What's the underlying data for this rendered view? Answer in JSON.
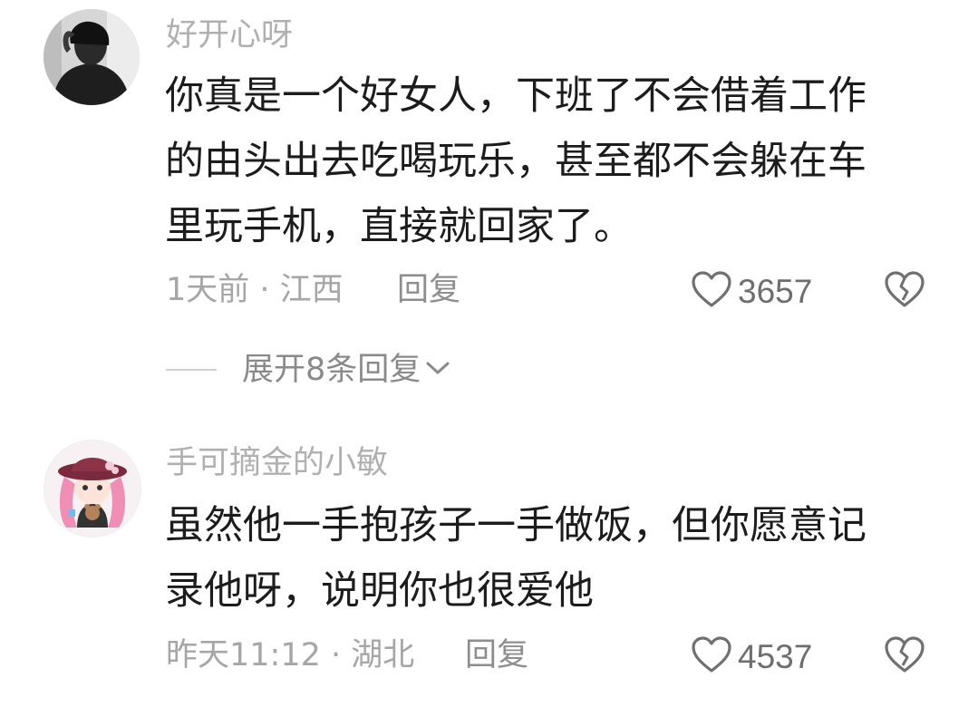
{
  "comments": [
    {
      "username": "好开心呀",
      "content_lines": [
        "你真是一个好女人，下班了不会借着工作",
        "的由头出去吃喝玩乐，甚至都不会躲在车",
        "里玩手机，直接就回家了。"
      ],
      "meta": "1天前 · 江西",
      "reply_label": "回复",
      "like_count": "3657",
      "avatar_icon": "person-photo-avatar",
      "expand_replies_label": "展开8条回复"
    },
    {
      "username": "手可摘金的小敏",
      "content_lines": [
        "虽然他一手抱孩子一手做饭，但你愿意记",
        "录他呀，说明你也很爱他"
      ],
      "meta": "昨天11:12 · 湖北",
      "reply_label": "回复",
      "like_count": "4537",
      "avatar_icon": "anime-girl-pink-hat-avatar"
    }
  ],
  "colors": {
    "username": "#b0b0b0",
    "content": "#1c1c1c",
    "meta": "#a6a6a6",
    "icon": "#707070"
  }
}
